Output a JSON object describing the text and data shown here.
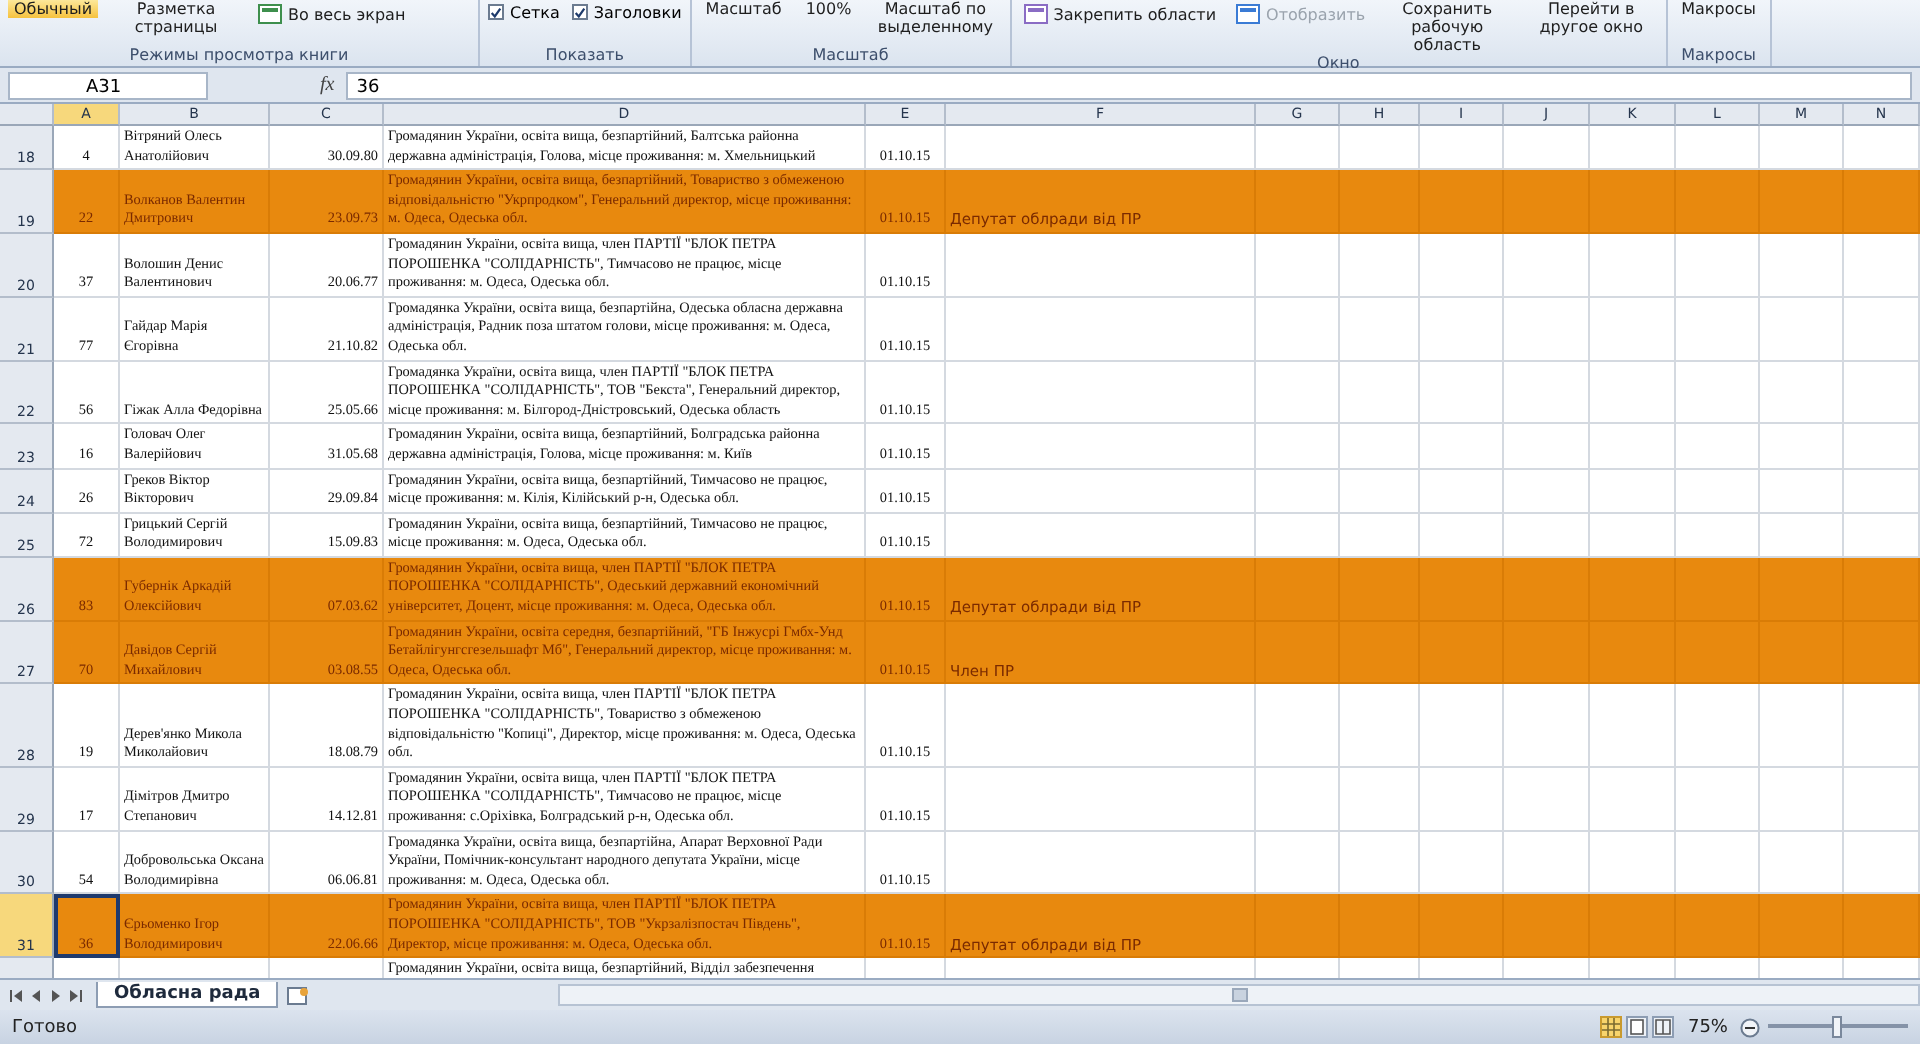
{
  "ribbon": {
    "groups": [
      {
        "label": "Режимы просмотра книги",
        "items": [
          {
            "kind": "large",
            "label": "Обычный",
            "selected": true
          },
          {
            "kind": "large",
            "label": "Разметка страницы",
            "selected": false
          },
          {
            "kind": "small",
            "label": "Во весь экран",
            "selected": false
          }
        ]
      },
      {
        "label": "Показать",
        "items": [
          {
            "kind": "checkbox",
            "label": "Сетка",
            "checked": true
          },
          {
            "kind": "checkbox",
            "label": "Заголовки",
            "checked": true
          }
        ]
      },
      {
        "label": "Масштаб",
        "items": [
          {
            "kind": "large",
            "label": "Масштаб",
            "selected": false
          },
          {
            "kind": "large",
            "label": "100%",
            "selected": false
          },
          {
            "kind": "large",
            "label": "Масштаб по выделенному",
            "selected": false
          }
        ]
      },
      {
        "label": "Окно",
        "items": [
          {
            "kind": "small",
            "label": "Закрепить области",
            "selected": false
          },
          {
            "kind": "small",
            "label": "Отобразить",
            "disabled": true,
            "selected": false
          },
          {
            "kind": "large",
            "label": "Сохранить рабочую область",
            "selected": false
          },
          {
            "kind": "large",
            "label": "Перейти в другое окно",
            "selected": false
          }
        ]
      },
      {
        "label": "Макросы",
        "items": [
          {
            "kind": "large",
            "label": "Макросы",
            "selected": false
          }
        ]
      }
    ]
  },
  "formula_bar": {
    "name_box": "A31",
    "fx": "fx",
    "value": "36"
  },
  "columns": [
    {
      "label": "A",
      "selected": true
    },
    {
      "label": "B",
      "selected": false
    },
    {
      "label": "C",
      "selected": false
    },
    {
      "label": "D",
      "selected": false
    },
    {
      "label": "E",
      "selected": false
    },
    {
      "label": "F",
      "selected": false
    },
    {
      "label": "G",
      "selected": false
    },
    {
      "label": "H",
      "selected": false
    },
    {
      "label": "I",
      "selected": false
    },
    {
      "label": "J",
      "selected": false
    },
    {
      "label": "K",
      "selected": false
    },
    {
      "label": "L",
      "selected": false
    },
    {
      "label": "M",
      "selected": false
    },
    {
      "label": "N",
      "selected": false
    }
  ],
  "rows": [
    {
      "number": "18",
      "highlighted": false,
      "selected": false,
      "a": "4",
      "b": "Вітряний Олесь Анатолійович",
      "c": "30.09.80",
      "d": "Громадянин України, освіта вища, безпартійний, Балтська районна державна адміністрація, Голова, місце проживання: м. Хмельницький",
      "e": "01.10.15"
    },
    {
      "number": "19",
      "highlighted": true,
      "selected": false,
      "a": "22",
      "b": "Волканов Валентин Дмитрович",
      "c": "23.09.73",
      "d": "Громадянин України, освіта вища, безпартійний, Товариство з обмеженою відповідальністю \"Укрпродком\", Генеральний директор, місце проживання: м. Одеса, Одеська обл.",
      "e": "01.10.15",
      "f": "Депутат облради від ПР"
    },
    {
      "number": "20",
      "highlighted": false,
      "selected": false,
      "a": "37",
      "b": "Волошин Денис Валентинович",
      "c": "20.06.77",
      "d": "Громадянин України, освіта вища, член ПАРТІЇ \"БЛОК ПЕТРА ПОРОШЕНКА \"СОЛІДАРНІСТЬ\", Тимчасово не працює, місце проживання: м. Одеса, Одеська обл.",
      "e": "01.10.15"
    },
    {
      "number": "21",
      "highlighted": false,
      "selected": false,
      "a": "77",
      "b": "Гайдар Марія Єгорівна",
      "c": "21.10.82",
      "d": "Громадянка України, освіта вища, безпартійна, Одеська обласна державна адміністрація, Радник поза штатом голови, місце проживання: м. Одеса, Одеська обл.",
      "e": "01.10.15"
    },
    {
      "number": "22",
      "highlighted": false,
      "selected": false,
      "a": "56",
      "b": "Гіжак Алла Федорівна",
      "c": "25.05.66",
      "d": "Громадянка України, освіта вища, член ПАРТІЇ \"БЛОК ПЕТРА ПОРОШЕНКА \"СОЛІДАРНІСТЬ\", ТОВ \"Бекста\", Генеральний директор, місце проживання: м. Білгород-Дністровський, Одеська область",
      "e": "01.10.15"
    },
    {
      "number": "23",
      "highlighted": false,
      "selected": false,
      "a": "16",
      "b": "Головач Олег Валерійович",
      "c": "31.05.68",
      "d": "Громадянин України, освіта вища, безпартійний, Болградська районна державна адміністрація, Голова, місце проживання: м. Київ",
      "e": "01.10.15"
    },
    {
      "number": "24",
      "highlighted": false,
      "selected": false,
      "a": "26",
      "b": "Греков Віктор Вікторович",
      "c": "29.09.84",
      "d": "Громадянин України, освіта вища, безпартійний, Тимчасово не працює, місце проживання: м. Кілія, Кілійський р-н, Одеська обл.",
      "e": "01.10.15"
    },
    {
      "number": "25",
      "highlighted": false,
      "selected": false,
      "a": "72",
      "b": "Грицький Сергій Володимирович",
      "c": "15.09.83",
      "d": "Громадянин України, освіта вища, безпартійний, Тимчасово не працює, місце проживання: м. Одеса, Одеська обл.",
      "e": "01.10.15"
    },
    {
      "number": "26",
      "highlighted": true,
      "selected": false,
      "a": "83",
      "b": "Губернік Аркадій Олексійович",
      "c": "07.03.62",
      "d": "Громадянин України, освіта вища, член ПАРТІЇ \"БЛОК ПЕТРА ПОРОШЕНКА \"СОЛІДАРНІСТЬ\", Одеський державний економічний університет, Доцент, місце проживання: м. Одеса, Одеська обл.",
      "e": "01.10.15",
      "f": "Депутат облради від ПР"
    },
    {
      "number": "27",
      "highlighted": true,
      "selected": false,
      "a": "70",
      "b": "Давідов Сергій Михайлович",
      "c": "03.08.55",
      "d": "Громадянин України, освіта середня, безпартійний, \"ГБ Інжусрі Гмбх-Унд Бетайлігунгсгезельшафт Мб\", Генеральний директор, місце проживання: м. Одеса, Одеська обл.",
      "e": "01.10.15",
      "f": "Член ПР"
    },
    {
      "number": "28",
      "highlighted": false,
      "selected": false,
      "a": "19",
      "b": "Дерев'янко Микола Миколайович",
      "c": "18.08.79",
      "d": "Громадянин України, освіта вища, член ПАРТІЇ \"БЛОК ПЕТРА ПОРОШЕНКА \"СОЛІДАРНІСТЬ\", Товариство з обмеженою відповідальністю \"Копиці\", Директор, місце проживання: м. Одеса, Одеська обл.",
      "e": "01.10.15"
    },
    {
      "number": "29",
      "highlighted": false,
      "selected": false,
      "a": "17",
      "b": "Дімітров Дмитро Степанович",
      "c": "14.12.81",
      "d": "Громадянин України, освіта вища, член ПАРТІЇ \"БЛОК ПЕТРА ПОРОШЕНКА \"СОЛІДАРНІСТЬ\", Тимчасово не працює, місце проживання: с.Оріхівка, Болградський р-н, Одеська обл.",
      "e": "01.10.15"
    },
    {
      "number": "30",
      "highlighted": false,
      "selected": false,
      "a": "54",
      "b": "Добровольська Оксана Володимирівна",
      "c": "06.06.81",
      "d": "Громадянка України, освіта вища, безпартійна, Апарат Верховної Ради України, Помічник-консультант народного депутата України, місце проживання: м. Одеса, Одеська обл.",
      "e": "01.10.15"
    },
    {
      "number": "31",
      "highlighted": true,
      "selected": true,
      "a": "36",
      "b": "Єрьоменко Ігор Володимирович",
      "c": "22.06.66",
      "d": "Громадянин України, освіта вища, член ПАРТІЇ \"БЛОК ПЕТРА ПОРОШЕНКА \"СОЛІДАРНІСТЬ\", ТОВ \"Укрзалізпостач Південь\", Директор, місце проживання: м. Одеса, Одеська обл.",
      "e": "01.10.15",
      "f": "Депутат облради від ПР"
    },
    {
      "d": "Громадянин України, освіта вища, безпартійний, Відділ забезпечення"
    }
  ],
  "sheet_tabs": [
    {
      "label": "Обласна рада",
      "selected": true
    }
  ],
  "status_bar": {
    "status": "Готово",
    "views": [
      {
        "kind": "normal",
        "selected": true
      },
      {
        "kind": "layout",
        "selected": false
      },
      {
        "kind": "pagebreak",
        "selected": false
      }
    ],
    "zoom": "75%",
    "zoom_slider": {
      "level": 0.5
    }
  }
}
